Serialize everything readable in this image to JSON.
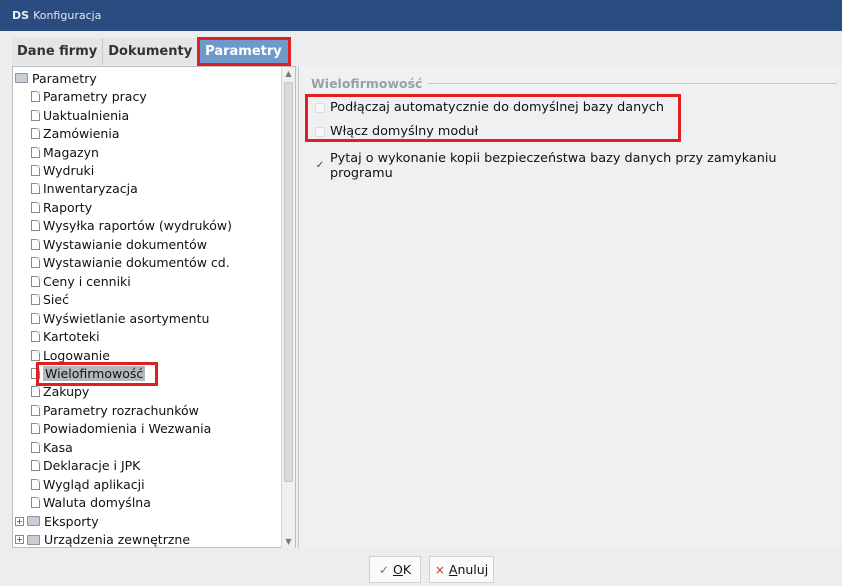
{
  "window": {
    "logo": "DS",
    "title": "Konfiguracja"
  },
  "tabs": [
    {
      "label": "Dane firmy"
    },
    {
      "label": "Dokumenty"
    },
    {
      "label": "Parametry"
    }
  ],
  "tree": {
    "root": "Parametry",
    "items": [
      "Parametry pracy",
      "Uaktualnienia",
      "Zamówienia",
      "Magazyn",
      "Wydruki",
      "Inwentaryzacja",
      "Raporty",
      "Wysyłka raportów (wydruków)",
      "Wystawianie dokumentów",
      "Wystawianie dokumentów cd.",
      "Ceny i cenniki",
      "Sieć",
      "Wyświetlanie asortymentu",
      "Kartoteki",
      "Logowanie",
      "Wielofirmowość",
      "Zakupy",
      "Parametry rozrachunków",
      "Powiadomienia i Wezwania",
      "Kasa",
      "Deklaracje i JPK",
      "Wygląd aplikacji",
      "Waluta domyślna"
    ],
    "groups": [
      "Eksporty",
      "Urządzenia zewnętrzne"
    ],
    "selected": "Wielofirmowość"
  },
  "section": {
    "title": "Wielofirmowość",
    "options": [
      {
        "label": "Podłączaj automatycznie do domyślnej bazy danych",
        "checked": false
      },
      {
        "label": "Włącz domyślny moduł",
        "checked": false
      },
      {
        "label": "Pytaj o wykonanie kopii bezpieczeństwa bazy danych przy zamykaniu programu",
        "checked": true
      }
    ]
  },
  "buttons": {
    "ok_label": "OK",
    "ok_underline": "O",
    "ok_rest": "K",
    "cancel_underline": "A",
    "cancel_rest": "nuluj"
  },
  "icons": {
    "ok": "check-icon",
    "cancel": "x-icon",
    "tree_leaf": "document-icon",
    "tree_folder": "folder-icon"
  },
  "colors": {
    "titlebar": "#2a4c80",
    "active_tab": "#6e9acb",
    "highlight": "#e02020"
  }
}
